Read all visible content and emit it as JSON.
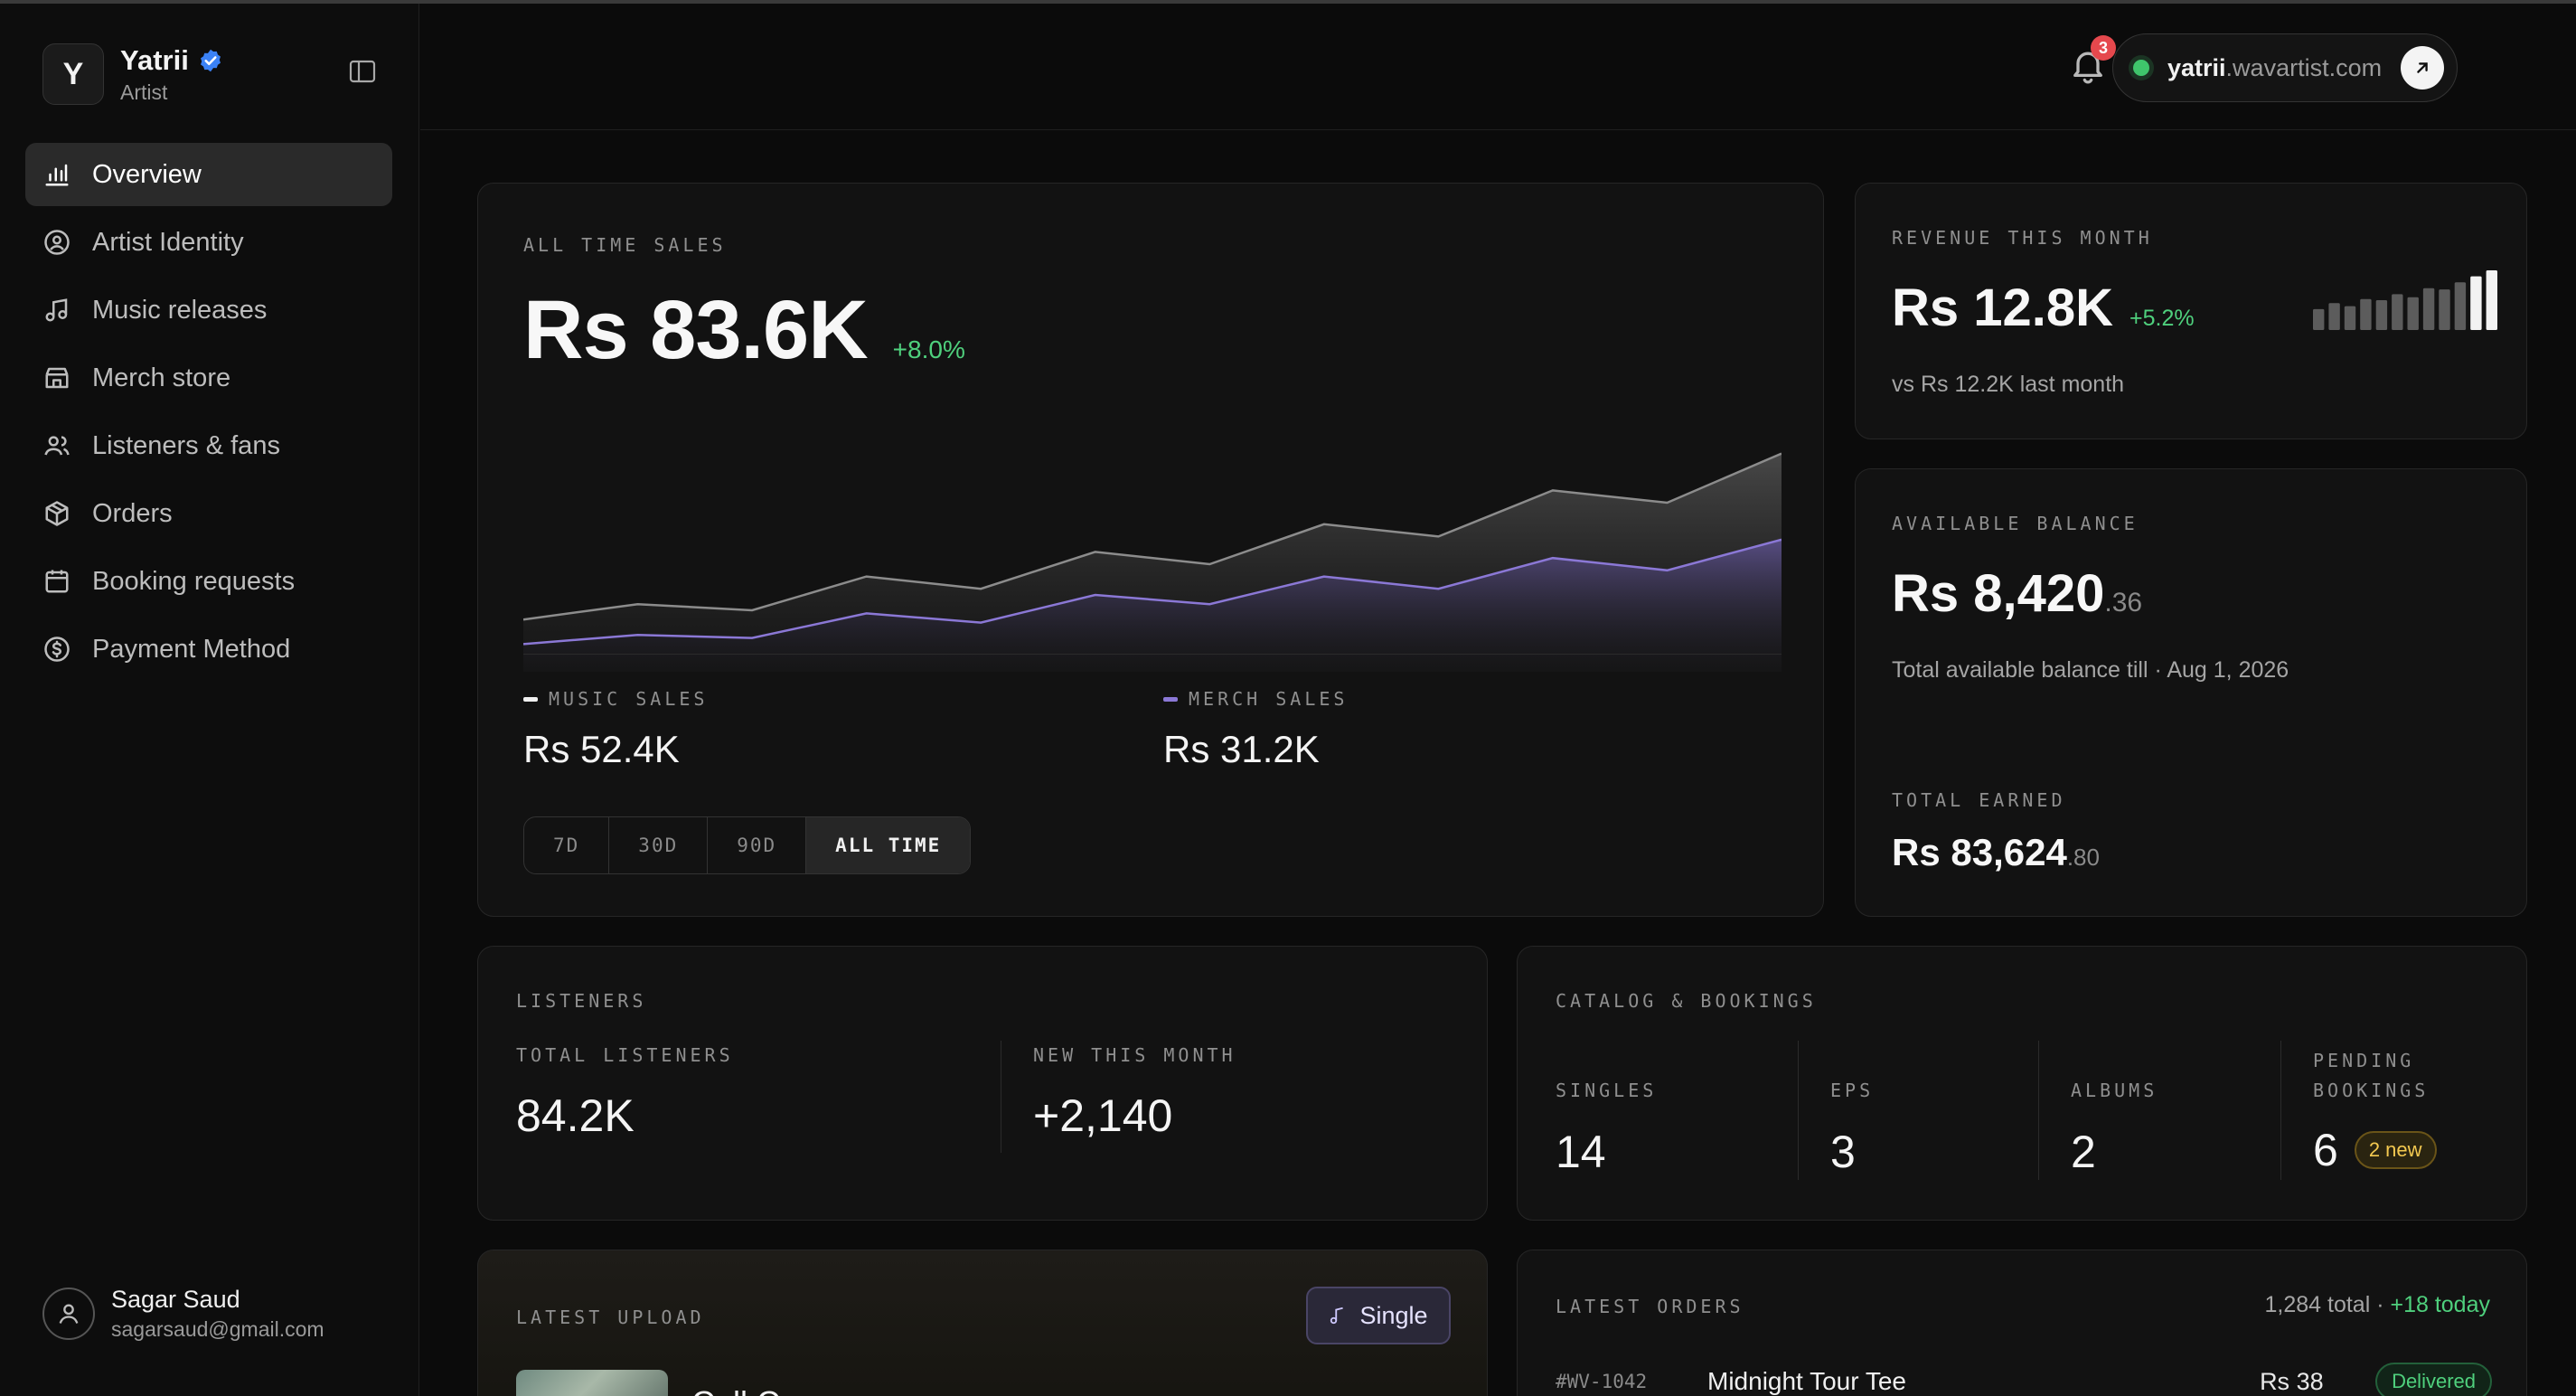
{
  "brand": {
    "initial": "Y",
    "name": "Yatrii",
    "role": "Artist"
  },
  "nav": [
    {
      "label": "Overview",
      "icon": "bar-chart-icon",
      "active": true
    },
    {
      "label": "Artist Identity",
      "icon": "user-circle-icon"
    },
    {
      "label": "Music releases",
      "icon": "music-note-icon"
    },
    {
      "label": "Merch store",
      "icon": "store-icon"
    },
    {
      "label": "Listeners & fans",
      "icon": "users-icon"
    },
    {
      "label": "Orders",
      "icon": "package-icon"
    },
    {
      "label": "Booking requests",
      "icon": "calendar-icon"
    },
    {
      "label": "Payment Method",
      "icon": "dollar-circle-icon"
    }
  ],
  "user": {
    "name": "Sagar Saud",
    "email": "sagarsaud@gmail.com"
  },
  "header": {
    "site_name": "yatrii",
    "site_domain": ".wavartist.com",
    "notifications": "3"
  },
  "sales": {
    "eyebrow": "ALL TIME SALES",
    "amount": "Rs 83.6K",
    "delta": "+8.0%",
    "music_label": "MUSIC SALES",
    "music_value": "Rs 52.4K",
    "merch_label": "MERCH SALES",
    "merch_value": "Rs 31.2K",
    "ranges": [
      "7D",
      "30D",
      "90D",
      "ALL TIME"
    ],
    "active_range": "ALL TIME",
    "colors": {
      "total": "#8c8c8c",
      "merch": "#8b78d6"
    }
  },
  "revenue": {
    "eyebrow": "REVENUE THIS MONTH",
    "amount": "Rs 12.8K",
    "delta": "+5.2%",
    "sub": "vs Rs 12.2K last month",
    "bars": [
      0.35,
      0.45,
      0.4,
      0.52,
      0.5,
      0.6,
      0.55,
      0.7,
      0.68,
      0.8,
      0.9,
      1.0
    ]
  },
  "balance": {
    "eyebrow": "AVAILABLE BALANCE",
    "amount": "Rs 8,420",
    "cents": ".36",
    "sub": "Total available balance till · Aug 1, 2026",
    "earned_label": "TOTAL EARNED",
    "earned_amount": "Rs 83,624",
    "earned_cents": ".80"
  },
  "listeners": {
    "eyebrow": "LISTENERS",
    "total_label": "TOTAL LISTENERS",
    "total_value": "84.2K",
    "new_label": "NEW THIS MONTH",
    "new_value": "+2,140"
  },
  "catalog": {
    "eyebrow": "CATALOG & BOOKINGS",
    "singles_label": "SINGLES",
    "singles_value": "14",
    "eps_label": "EPS",
    "eps_value": "3",
    "albums_label": "ALBUMS",
    "albums_value": "2",
    "pending_label_1": "PENDING",
    "pending_label_2": "BOOKINGS",
    "pending_value": "6",
    "pending_badge": "2 new"
  },
  "upload": {
    "eyebrow": "LATEST UPLOAD",
    "type_label": "Single",
    "title": "Call Can..."
  },
  "orders": {
    "eyebrow": "LATEST ORDERS",
    "total": "1,284 total ·",
    "today": "+18 today",
    "rows": [
      {
        "id": "#WV-1042",
        "name": "Midnight Tour Tee",
        "price": "Rs 38",
        "status": "Delivered"
      }
    ]
  },
  "chart_data": {
    "type": "area",
    "x": [
      0,
      1,
      2,
      3,
      4,
      5,
      6,
      7,
      8,
      9,
      10,
      11
    ],
    "series": [
      {
        "values": [
          17,
          22,
          20,
          31,
          27,
          39,
          35,
          48,
          44,
          59,
          55,
          71
        ]
      },
      {
        "values": [
          9,
          12,
          11,
          19,
          16,
          25,
          22,
          31,
          27,
          37,
          33,
          43
        ]
      }
    ],
    "ylim": [
      0,
      80
    ],
    "grid": false
  }
}
